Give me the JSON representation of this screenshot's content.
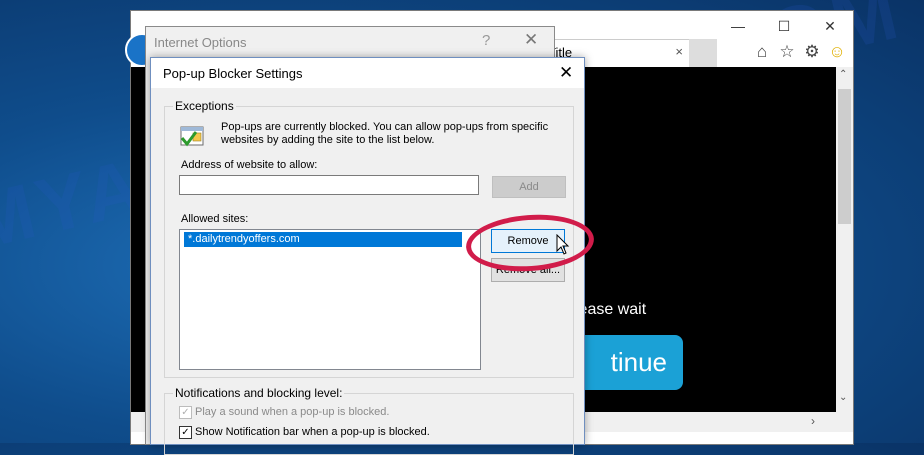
{
  "browser": {
    "tab_title": "Title",
    "tab_close": "×",
    "caption": {
      "minimize": "—",
      "maximize": "☐",
      "close": "✕"
    },
    "page": {
      "please_wait": "lease wait",
      "continue_label": "tinue"
    },
    "toolbar_icons": [
      "home-icon",
      "star-icon",
      "gear-icon",
      "smiley-icon"
    ]
  },
  "internet_options": {
    "title": "Internet Options",
    "help": "?",
    "close": "✕"
  },
  "popup_blocker": {
    "title": "Pop-up Blocker Settings",
    "close": "✕",
    "exceptions": {
      "group_label": "Exceptions",
      "info_text": "Pop-ups are currently blocked.  You can allow pop-ups from specific websites by adding the site to the list below.",
      "address_label": "Address of website to allow:",
      "address_value": "",
      "add_button": "Add",
      "allowed_label": "Allowed sites:",
      "allowed_sites": [
        "*.dailytrendyoffers.com"
      ],
      "remove_button": "Remove",
      "remove_all_button": "Remove all..."
    },
    "notifications": {
      "group_label": "Notifications and blocking level:",
      "play_sound": "Play a sound when a pop-up is blocked.",
      "play_sound_checked": true,
      "show_bar": "Show Notification bar when a pop-up is blocked.",
      "show_bar_checked": true
    }
  },
  "watermark": "MYANTISPYWARE.COM",
  "colors": {
    "accent": "#0078d7",
    "highlight_ring": "#d11c4a",
    "continue_button": "#1ba1d6"
  }
}
